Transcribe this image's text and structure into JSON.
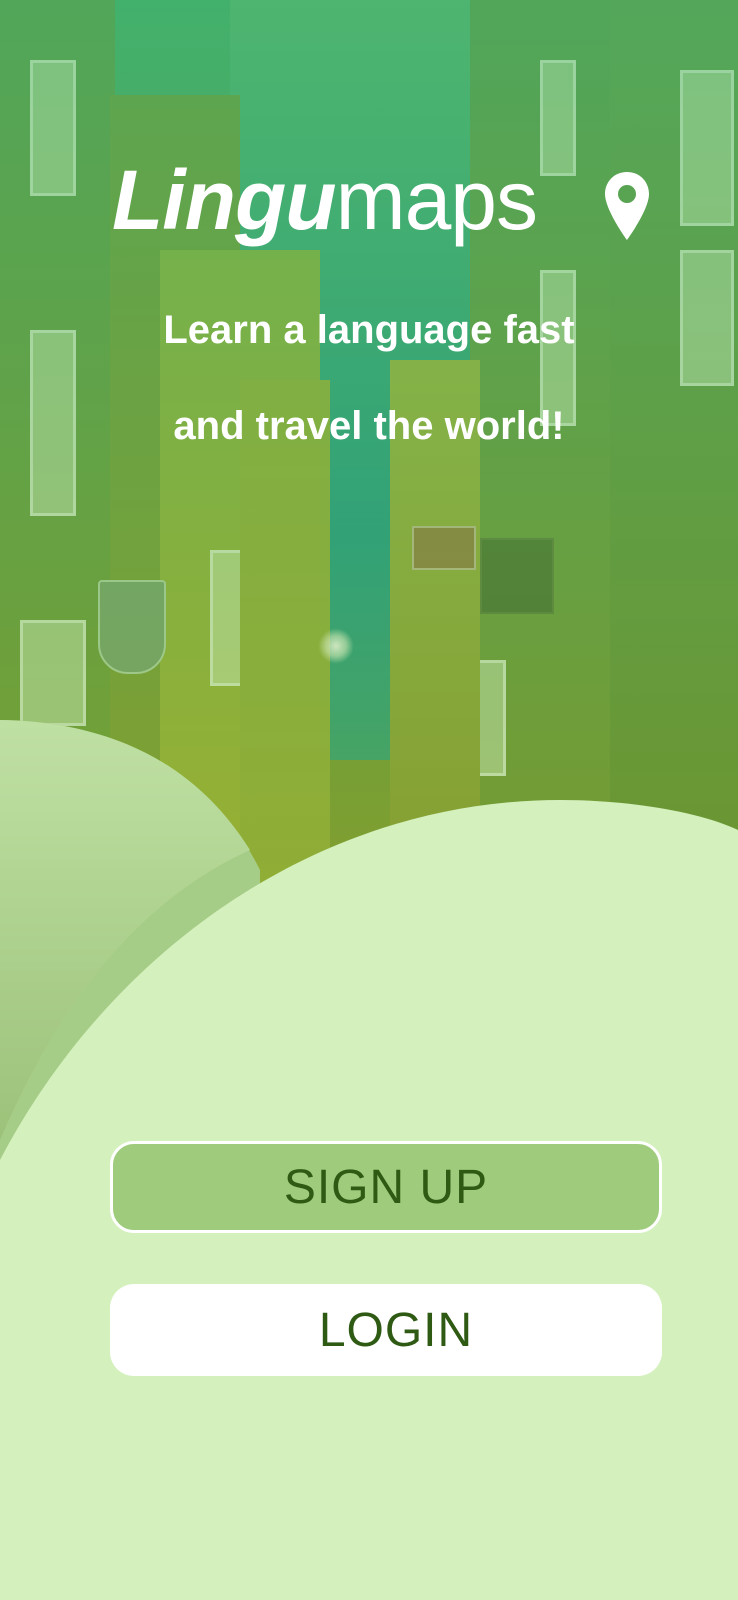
{
  "brand": {
    "name_bold": "Lingu",
    "name_light": "maps",
    "icon": "map-pin-icon"
  },
  "tagline": {
    "line1": "Learn a language fast",
    "line2": "and travel the world!"
  },
  "buttons": {
    "signup_label": "SIGN UP",
    "login_label": "LOGIN"
  },
  "colors": {
    "background": "#d4f0bd",
    "signup_fill": "#9fcb7c",
    "button_text": "#2e5a14",
    "hero_tint": "#3fae6a"
  }
}
